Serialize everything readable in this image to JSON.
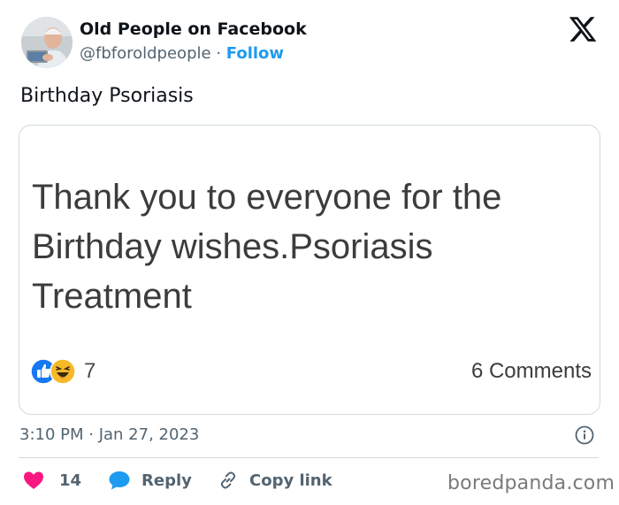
{
  "author": {
    "name": "Old People on Facebook",
    "handle": "@fbforoldpeople",
    "separator": "·",
    "follow_label": "Follow"
  },
  "tweet": {
    "text": "Birthday Psoriasis",
    "timestamp": "3:10 PM · Jan 27, 2023"
  },
  "embedded_post": {
    "text": "Thank you to everyone for the Birthday wishes.Psoriasis Treatment",
    "reaction_count": "7",
    "comments": "6 Comments"
  },
  "actions": {
    "like_count": "14",
    "reply_label": "Reply",
    "copy_link_label": "Copy link"
  },
  "watermark": "boredpanda.com",
  "colors": {
    "like": "#f91880",
    "reply": "#1d9bf0",
    "follow": "#1d9bf0",
    "fb_like": "#1877f2",
    "fb_haha": "#f7b928"
  },
  "icons": [
    "x-logo-icon",
    "info-icon",
    "heart-icon",
    "reply-bubble-icon",
    "link-icon",
    "fb-like-icon",
    "fb-haha-icon"
  ]
}
